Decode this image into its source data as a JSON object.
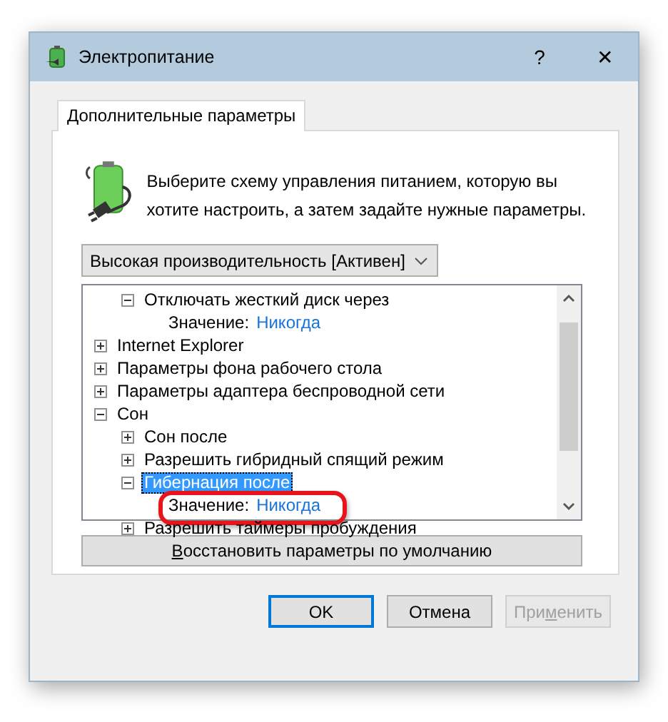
{
  "window": {
    "title": "Электропитание",
    "help": "?",
    "close": "✕"
  },
  "tabs": [
    {
      "label": "Дополнительные параметры",
      "selected": true
    }
  ],
  "description": "Выберите схему управления питанием, которую вы хотите настроить, а затем задайте нужные параметры.",
  "plan_dropdown": {
    "value": "Высокая производительность [Активен]"
  },
  "tree": {
    "continued_children": [
      {
        "kind": "node",
        "label": "Отключать жесткий диск через",
        "expanded": true,
        "selected": false,
        "children": [
          {
            "kind": "value",
            "label": "Значение:",
            "value": "Никогда"
          }
        ]
      }
    ],
    "items": [
      {
        "kind": "node",
        "label": "Internet Explorer",
        "expanded": false,
        "selected": false
      },
      {
        "kind": "node",
        "label": "Параметры фона рабочего стола",
        "expanded": false,
        "selected": false
      },
      {
        "kind": "node",
        "label": "Параметры адаптера беспроводной сети",
        "expanded": false,
        "selected": false
      },
      {
        "kind": "node",
        "label": "Сон",
        "expanded": true,
        "selected": false,
        "children": [
          {
            "kind": "node",
            "label": "Сон после",
            "expanded": false,
            "selected": false
          },
          {
            "kind": "node",
            "label": "Разрешить гибридный спящий режим",
            "expanded": false,
            "selected": false
          },
          {
            "kind": "node",
            "label": "Гибернация после",
            "expanded": true,
            "selected": true,
            "children": [
              {
                "kind": "value",
                "label": "Значение:",
                "value": "Никогда",
                "annotated": true
              }
            ]
          },
          {
            "kind": "node",
            "label": "Разрешить таймеры пробуждения",
            "expanded": false,
            "selected": false
          }
        ]
      }
    ]
  },
  "restore_button": {
    "key": "В",
    "rest": "осстановить параметры по умолчанию"
  },
  "buttons": [
    {
      "lead": "OK",
      "default": true,
      "disabled": false
    },
    {
      "lead": "Отмена",
      "default": false,
      "disabled": false
    },
    {
      "lead": "При",
      "key": "м",
      "rest": "енить",
      "default": false,
      "disabled": true
    }
  ]
}
